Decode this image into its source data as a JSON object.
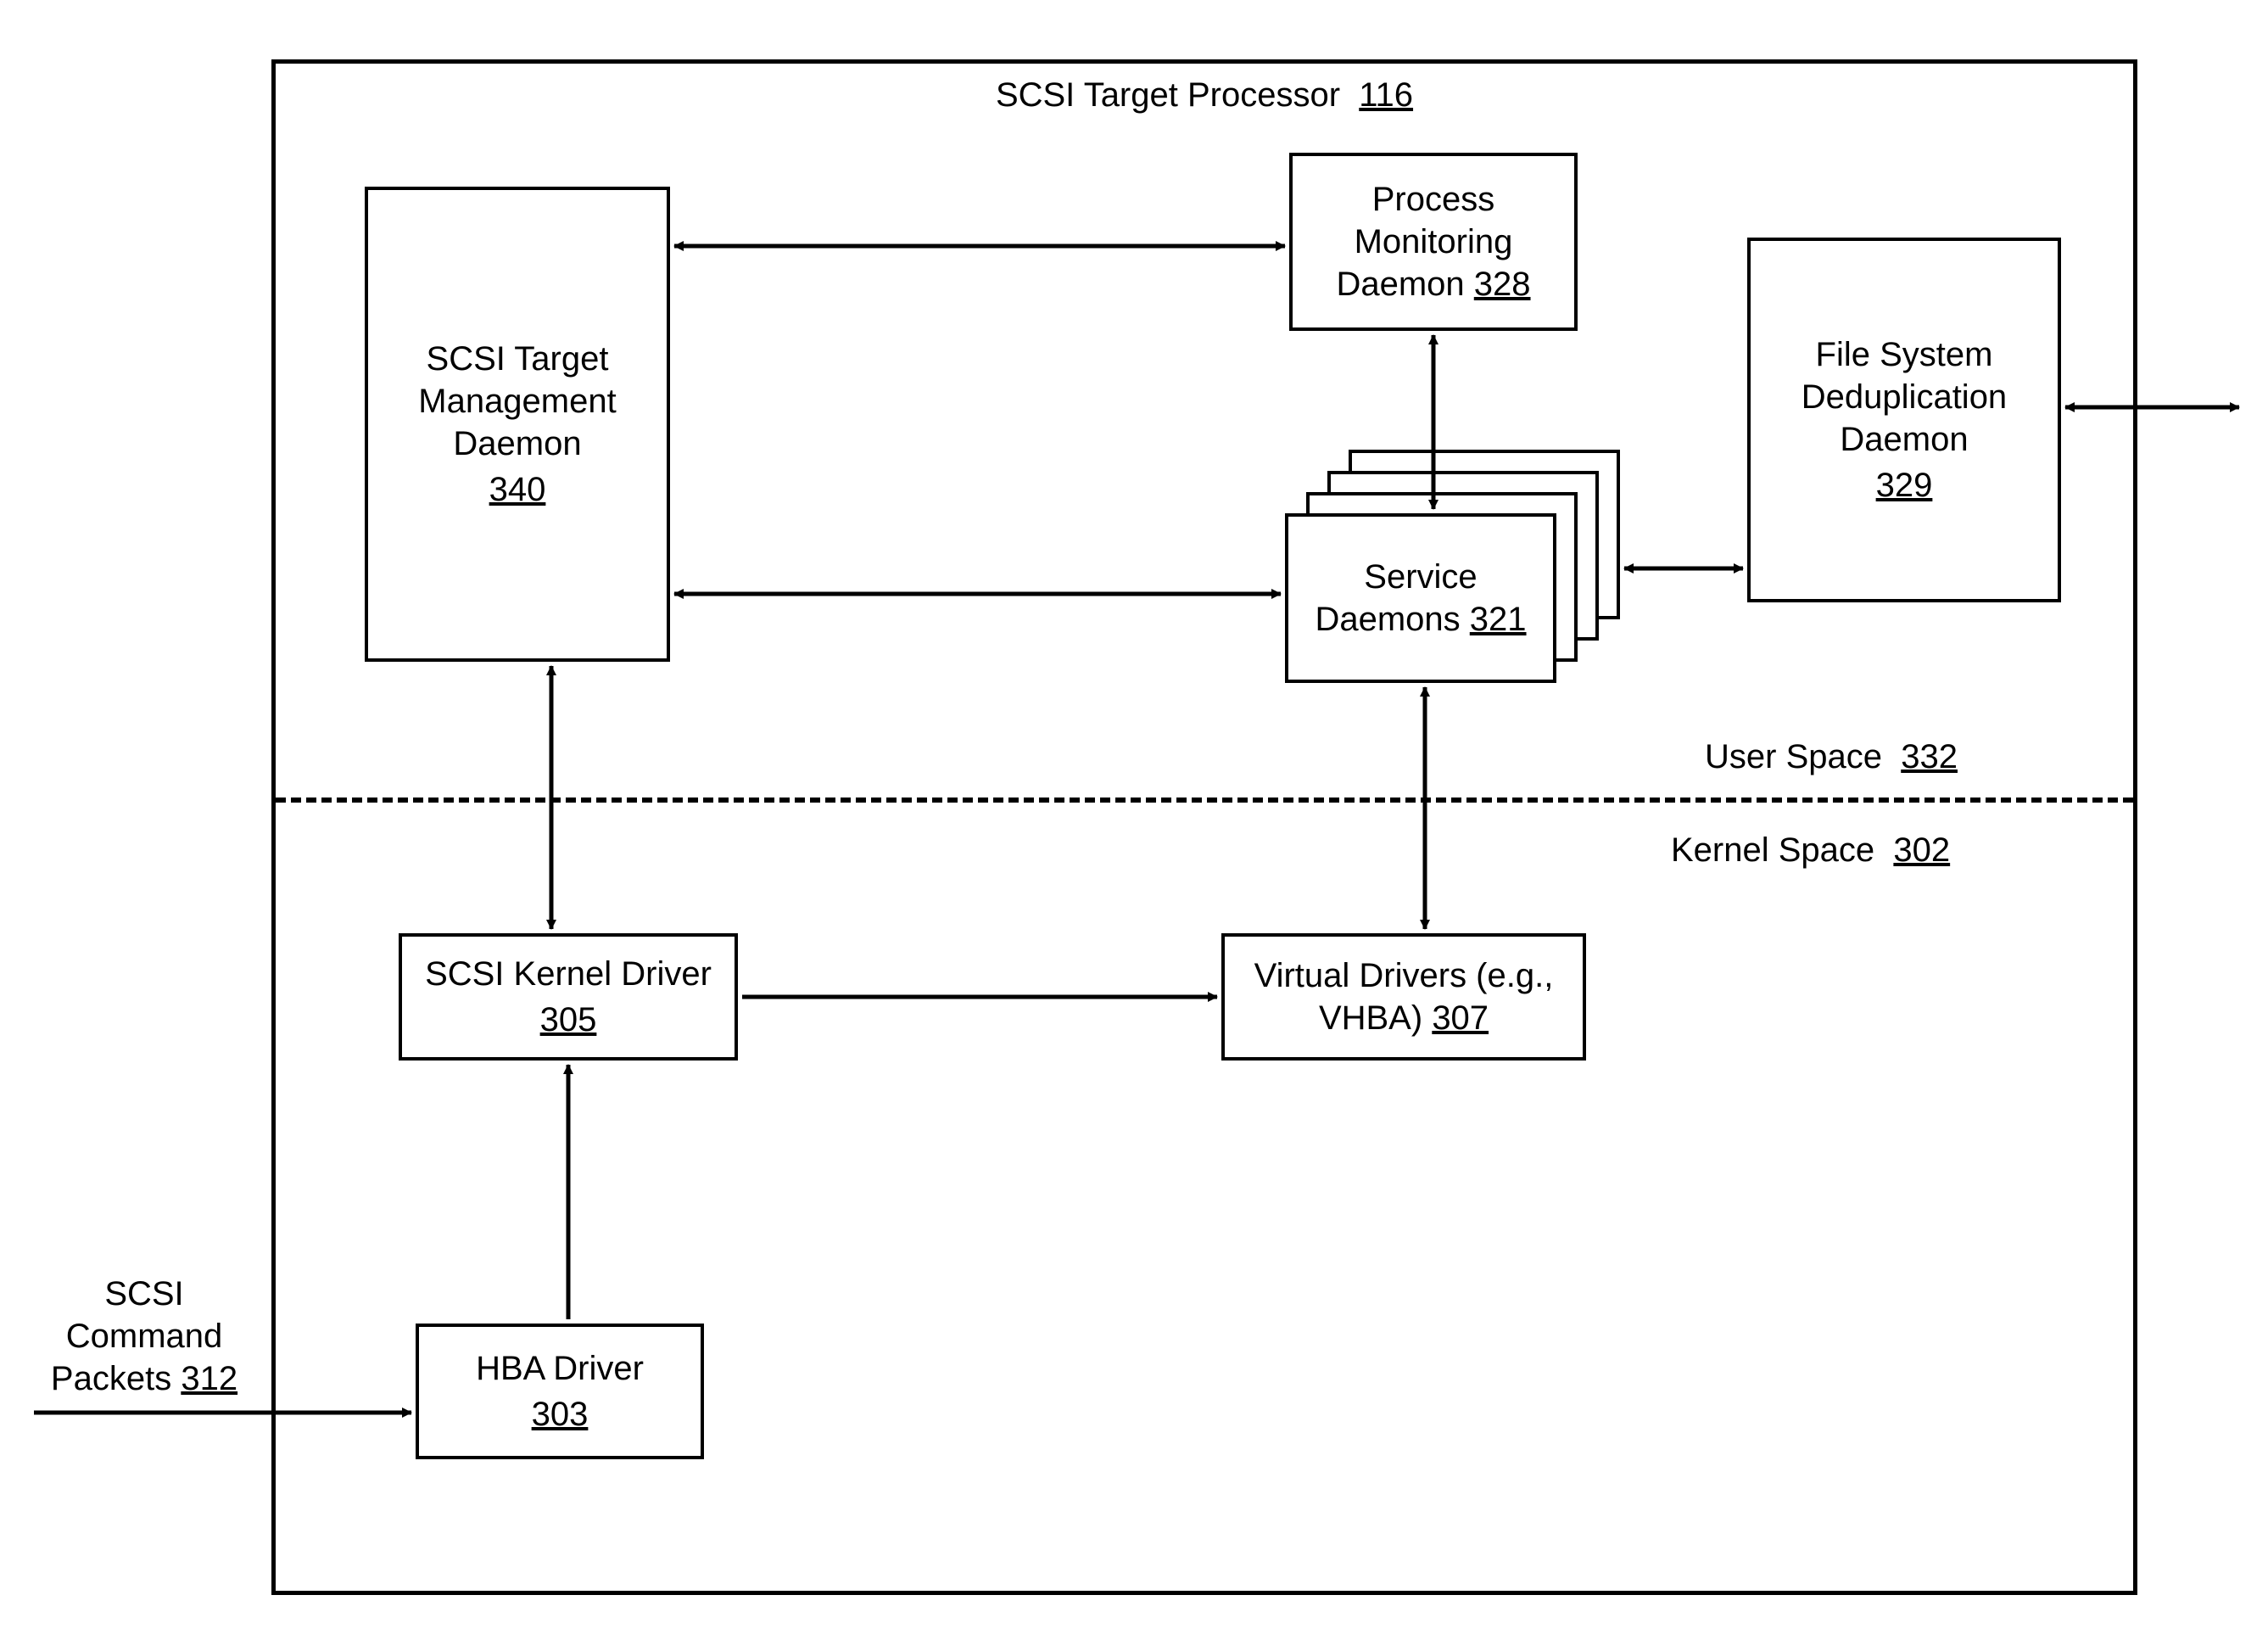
{
  "frame": {
    "title": "SCSI Target Processor",
    "title_ref": "116"
  },
  "regions": {
    "user_space": {
      "label": "User Space",
      "ref": "332"
    },
    "kernel_space": {
      "label": "Kernel Space",
      "ref": "302"
    }
  },
  "boxes": {
    "mgmt_daemon": {
      "line1": "SCSI Target",
      "line2": "Management",
      "line3": "Daemon",
      "ref": "340"
    },
    "proc_mon": {
      "line1": "Process",
      "line2": "Monitoring",
      "line3": "Daemon",
      "ref": "328"
    },
    "fs_dedupe": {
      "line1": "File System",
      "line2": "Deduplication",
      "line3": "Daemon",
      "ref": "329"
    },
    "svc_daemons": {
      "line1": "Service",
      "line2": "Daemons",
      "ref": "321"
    },
    "scsi_kernel": {
      "line1": "SCSI Kernel Driver",
      "ref": "305"
    },
    "virt_drivers": {
      "line1": "Virtual Drivers (e.g.,",
      "line2": "VHBA)",
      "ref": "307"
    },
    "hba_driver": {
      "line1": "HBA Driver",
      "ref": "303"
    }
  },
  "external": {
    "scsi_packets": {
      "line1": "SCSI",
      "line2": "Command",
      "line3": "Packets",
      "ref": "312"
    }
  }
}
